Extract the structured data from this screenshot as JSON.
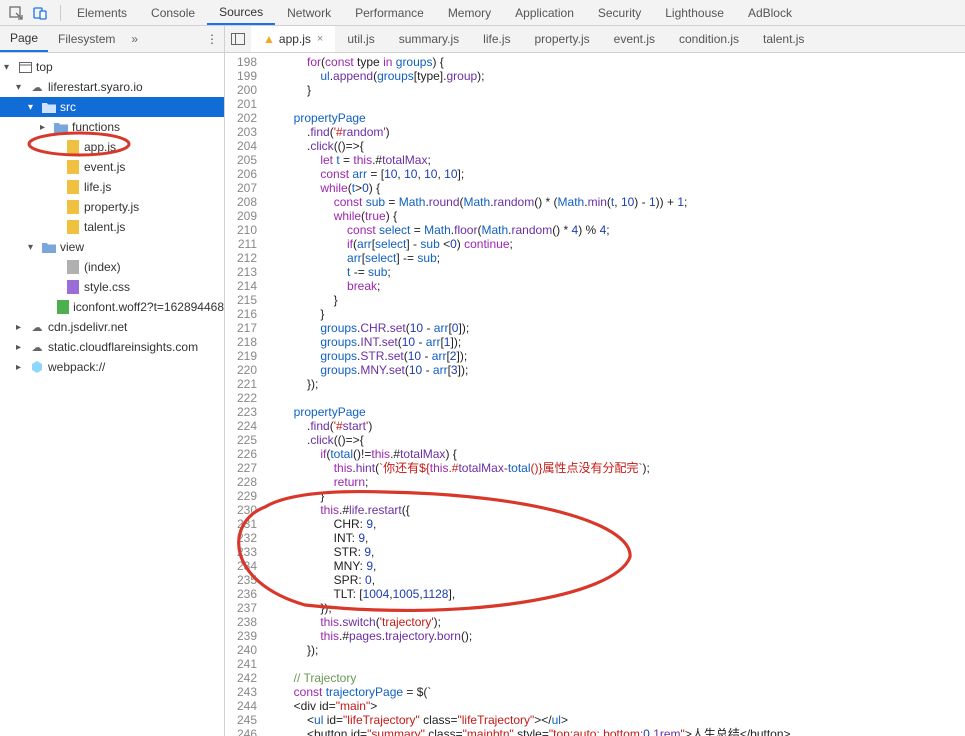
{
  "header": {
    "tabs": [
      "Elements",
      "Console",
      "Sources",
      "Network",
      "Performance",
      "Memory",
      "Application",
      "Security",
      "Lighthouse",
      "AdBlock"
    ],
    "selected": "Sources"
  },
  "leftNav": {
    "tabs": [
      "Page",
      "Filesystem"
    ],
    "selected": "Page",
    "more": "»"
  },
  "fileTabs": {
    "tabs": [
      "app.js",
      "util.js",
      "summary.js",
      "life.js",
      "property.js",
      "event.js",
      "condition.js",
      "talent.js"
    ],
    "active": "app.js",
    "warn": true
  },
  "tree": {
    "top": "top",
    "domain": "liferestart.syaro.io",
    "src": "src",
    "functions": "functions",
    "files_src": [
      "app.js",
      "event.js",
      "life.js",
      "property.js",
      "talent.js"
    ],
    "view": "view",
    "files_view": [
      "(index)",
      "style.css",
      "iconfont.woff2?t=162894468"
    ],
    "cdn": "cdn.jsdelivr.net",
    "static": "static.cloudflareinsights.com",
    "webpack": "webpack://"
  },
  "code": {
    "start": 198,
    "lines": [
      "            for(const type in groups) {",
      "                ul.append(groups[type].group);",
      "            }",
      "",
      "        propertyPage",
      "            .find('#random')",
      "            .click(()=>{",
      "                let t = this.#totalMax;",
      "                const arr = [10, 10, 10, 10];",
      "                while(t>0) {",
      "                    const sub = Math.round(Math.random() * (Math.min(t, 10) - 1)) + 1;",
      "                    while(true) {",
      "                        const select = Math.floor(Math.random() * 4) % 4;",
      "                        if(arr[select] - sub <0) continue;",
      "                        arr[select] -= sub;",
      "                        t -= sub;",
      "                        break;",
      "                    }",
      "                }",
      "                groups.CHR.set(10 - arr[0]);",
      "                groups.INT.set(10 - arr[1]);",
      "                groups.STR.set(10 - arr[2]);",
      "                groups.MNY.set(10 - arr[3]);",
      "            });",
      "",
      "        propertyPage",
      "            .find('#start')",
      "            .click(()=>{",
      "                if(total()!=this.#totalMax) {",
      "                    this.hint(`你还有${this.#totalMax-total()}属性点没有分配完`);",
      "                    return;",
      "                }",
      "                this.#life.restart({",
      "                    CHR: 9,",
      "                    INT: 9,",
      "                    STR: 9,",
      "                    MNY: 9,",
      "                    SPR: 0,",
      "                    TLT: [1004,1005,1128],",
      "                });",
      "                this.switch('trajectory');",
      "                this.#pages.trajectory.born();",
      "            });",
      "",
      "        // Trajectory",
      "        const trajectoryPage = $(`",
      "        <div id=\"main\">",
      "            <ul id=\"lifeTrajectory\" class=\"lifeTrajectory\"></ul>",
      "            <button id=\"summary\" class=\"mainbtn\" style=\"top:auto; bottom:0.1rem\">人生总结</button>"
    ]
  }
}
